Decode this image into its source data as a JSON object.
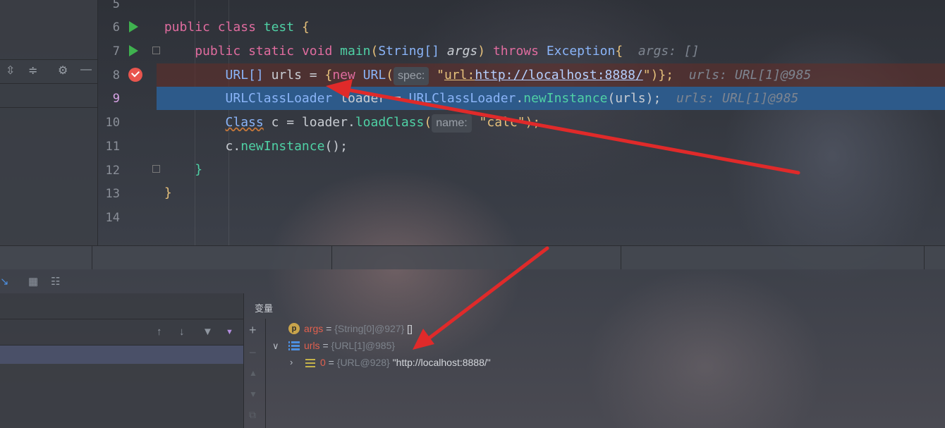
{
  "editor": {
    "lines": [
      {
        "num": "5"
      },
      {
        "num": "6"
      },
      {
        "num": "7"
      },
      {
        "num": "8"
      },
      {
        "num": "9"
      },
      {
        "num": "10"
      },
      {
        "num": "11"
      },
      {
        "num": "12"
      },
      {
        "num": "13"
      },
      {
        "num": "14"
      }
    ],
    "code": {
      "l6_kw1": "public",
      "l6_kw2": "class",
      "l6_name": "test",
      "l6_brace": "{",
      "l7_kw1": "public",
      "l7_kw2": "static",
      "l7_kw3": "void",
      "l7_fn": "main",
      "l7_open": "(",
      "l7_type": "String[]",
      "l7_param": "args",
      "l7_close": ")",
      "l7_throws": "throws",
      "l7_exc": "Exception",
      "l7_brace": "{",
      "l7_hint": "args: []",
      "l8_type": "URL[]",
      "l8_var": "urls",
      "l8_eq": "=",
      "l8_brace": "{",
      "l8_new": "new",
      "l8_ctor": "URL",
      "l8_open": "(",
      "l8_inlay": "spec:",
      "l8_q1": "\"",
      "l8_str1": "url:",
      "l8_url": "http://localhost:8888/",
      "l8_q2": "\"",
      "l8_end": ")};",
      "l8_hint": "urls: URL[1]@985",
      "l9_type": "URLClassLoader",
      "l9_var": "loader",
      "l9_eq": "=",
      "l9_cls": "URLClassLoader",
      "l9_dot": ".",
      "l9_fn": "newInstance",
      "l9_args": "(urls);",
      "l9_hint": "urls: URL[1]@985",
      "l10_type": "Class",
      "l10_var": "c",
      "l10_eq": "=",
      "l10_obj": "loader",
      "l10_dot": ".",
      "l10_fn": "loadClass",
      "l10_open": "(",
      "l10_inlay": "name:",
      "l10_str": "\"calc\"",
      "l10_end": ");",
      "l11_obj": "c",
      "l11_dot": ".",
      "l11_fn": "newInstance",
      "l11_end": "();",
      "l12_brace": "}",
      "l13_brace": "}"
    }
  },
  "variables": {
    "title": "变量",
    "rows": [
      {
        "badge": "p",
        "name": "args",
        "eq": " = ",
        "type": "{String[0]@927}",
        "value": " []"
      },
      {
        "name": "urls",
        "eq": " = ",
        "type": "{URL[1]@985}",
        "value": ""
      },
      {
        "name": "0",
        "eq": " = ",
        "type": "{URL@928}",
        "value": " \"http://localhost:8888/\""
      }
    ]
  },
  "colors": {
    "arrow": "#e02a2a",
    "exec_line": "#2d5a8a",
    "breakpoint": "#e8554e"
  },
  "icons": [
    "run-icon",
    "fold-icon",
    "breakpoint-icon",
    "gear-icon",
    "minimize-icon",
    "expand-all-icon",
    "collapse-all-icon",
    "step-into-icon",
    "table-icon",
    "arrow-up-icon",
    "arrow-down-icon",
    "filter-icon",
    "dropdown-icon",
    "add-icon",
    "chevron-icon",
    "parameter-icon",
    "list-icon",
    "field-icon"
  ]
}
